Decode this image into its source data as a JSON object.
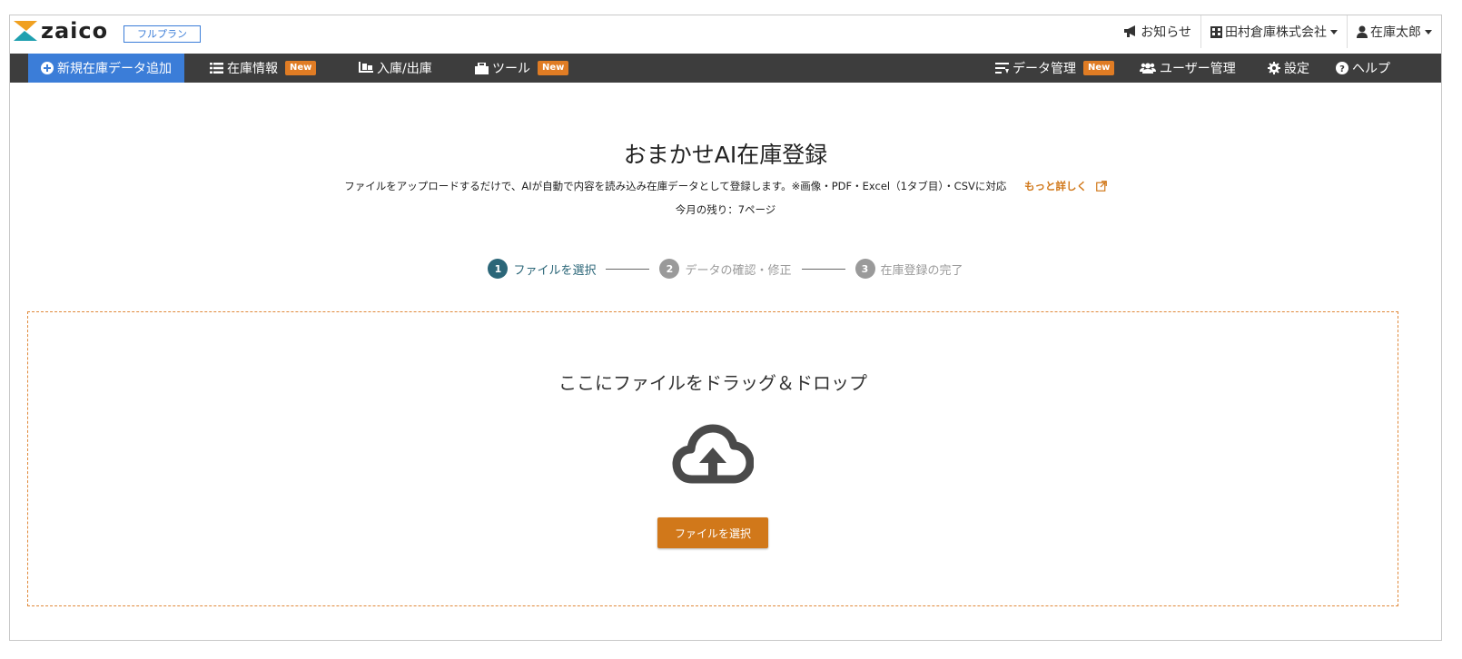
{
  "header": {
    "logo_text": "zaico",
    "plan_badge": "フルプラン",
    "notice_label": "お知らせ",
    "company_label": "田村倉庫株式会社",
    "user_label": "在庫太郎"
  },
  "nav": {
    "add_label": "新規在庫データ追加",
    "inventory_label": "在庫情報",
    "io_label": "入庫/出庫",
    "tools_label": "ツール",
    "data_mgmt_label": "データ管理",
    "user_mgmt_label": "ユーザー管理",
    "settings_label": "設定",
    "help_label": "ヘルプ",
    "new_badge": "New"
  },
  "main": {
    "title": "おまかせAI在庫登録",
    "description": "ファイルをアップロードするだけで、AIが自動で内容を読み込み在庫データとして登録します。※画像・PDF・Excel（1タブ目）・CSVに対応",
    "more_link": "もっと詳しく",
    "remaining": "今月の残り：7ページ"
  },
  "steps": [
    {
      "num": "1",
      "label": "ファイルを選択",
      "state": "active"
    },
    {
      "num": "2",
      "label": "データの確認・修正",
      "state": "inactive"
    },
    {
      "num": "3",
      "label": "在庫登録の完了",
      "state": "inactive"
    }
  ],
  "dropzone": {
    "text": "ここにファイルをドラッグ＆ドロップ",
    "button_label": "ファイルを選択",
    "icon": "cloud-upload-icon"
  },
  "colors": {
    "nav_bg": "#3d3d3d",
    "primary_blue": "#3b7dd8",
    "accent_orange": "#d1781a",
    "step_active": "#2b6678"
  }
}
